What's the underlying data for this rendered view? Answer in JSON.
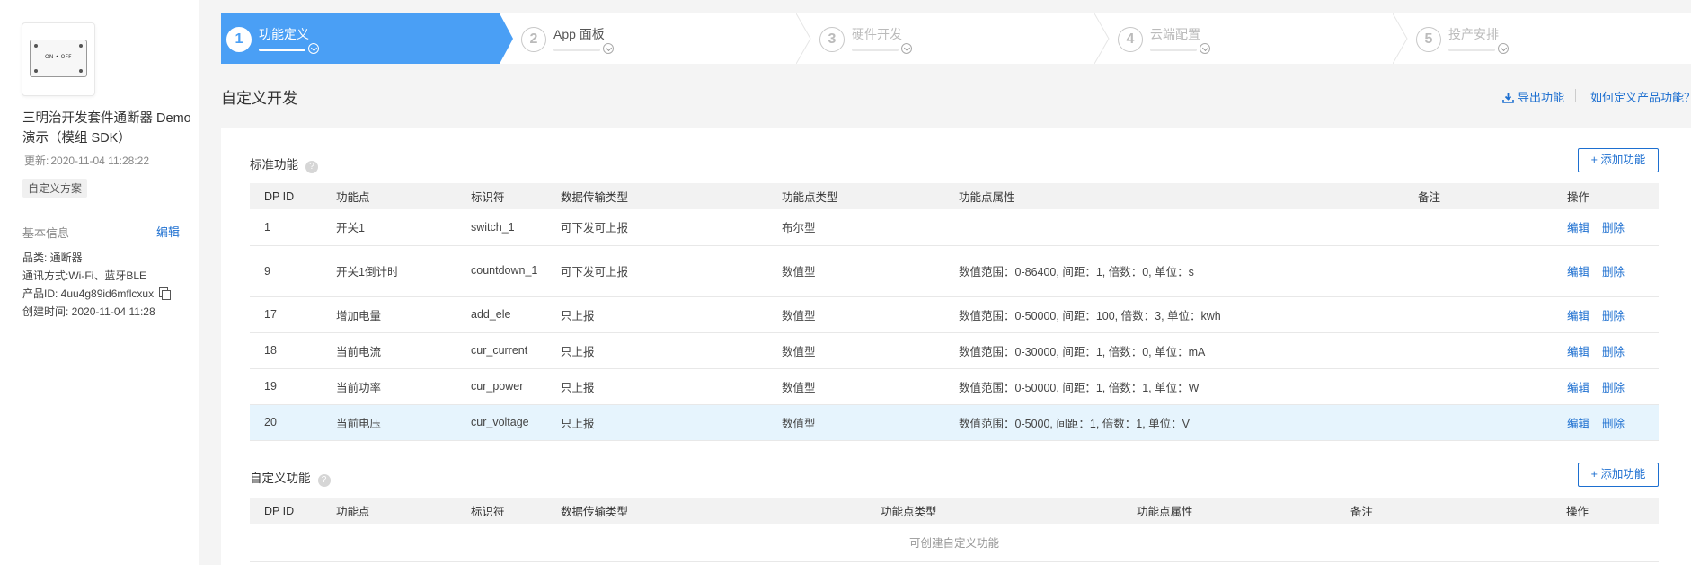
{
  "sidebar": {
    "product_image_text": "ON • OFF",
    "product_name": "三明治开发套件通断器 Demo 演示（模组 SDK）",
    "updated_label": "更新:",
    "updated_value": "2020-11-04 11:28:22",
    "solution_tag": "自定义方案",
    "basic_info_title": "基本信息",
    "edit_label": "编辑",
    "category": "品类: 通断器",
    "comm": "通讯方式:Wi-Fi、蓝牙BLE",
    "product_id": "产品ID: 4uu4g89id6mflcxux",
    "created": "创建时间: 2020-11-04 11:28"
  },
  "steps": [
    {
      "num": "1",
      "label": "功能定义",
      "active": true
    },
    {
      "num": "2",
      "label": "App 面板",
      "active": false
    },
    {
      "num": "3",
      "label": "硬件开发",
      "active": false
    },
    {
      "num": "4",
      "label": "云端配置",
      "active": false
    },
    {
      "num": "5",
      "label": "投产安排",
      "active": false
    }
  ],
  "header": {
    "title": "自定义开发",
    "export_label": "导出功能",
    "howto_label": "如何定义产品功能？"
  },
  "standard": {
    "title": "标准功能",
    "add_label": "+ 添加功能",
    "columns": [
      "DP ID",
      "功能点",
      "标识符",
      "数据传输类型",
      "功能点类型",
      "功能点属性",
      "备注",
      "操作"
    ],
    "rows": [
      {
        "id": "1",
        "name": "开关1",
        "code": "switch_1",
        "trans": "可下发可上报",
        "type": "布尔型",
        "attr": "",
        "note": "",
        "edit": "编辑",
        "del": "删除"
      },
      {
        "id": "9",
        "name": "开关1倒计时",
        "code": "countdown_1",
        "trans": "可下发可上报",
        "type": "数值型",
        "attr": "数值范围：0-86400, 间距：1, 倍数：0, 单位：s",
        "note": "",
        "edit": "编辑",
        "del": "删除"
      },
      {
        "id": "17",
        "name": "增加电量",
        "code": "add_ele",
        "trans": "只上报",
        "type": "数值型",
        "attr": "数值范围：0-50000, 间距：100, 倍数：3, 单位：kwh",
        "note": "",
        "edit": "编辑",
        "del": "删除"
      },
      {
        "id": "18",
        "name": "当前电流",
        "code": "cur_current",
        "trans": "只上报",
        "type": "数值型",
        "attr": "数值范围：0-30000, 间距：1, 倍数：0, 单位：mA",
        "note": "",
        "edit": "编辑",
        "del": "删除"
      },
      {
        "id": "19",
        "name": "当前功率",
        "code": "cur_power",
        "trans": "只上报",
        "type": "数值型",
        "attr": "数值范围：0-50000, 间距：1, 倍数：1, 单位：W",
        "note": "",
        "edit": "编辑",
        "del": "删除"
      },
      {
        "id": "20",
        "name": "当前电压",
        "code": "cur_voltage",
        "trans": "只上报",
        "type": "数值型",
        "attr": "数值范围：0-5000, 间距：1, 倍数：1, 单位：V",
        "note": "",
        "edit": "编辑",
        "del": "删除"
      }
    ]
  },
  "custom": {
    "title": "自定义功能",
    "add_label": "+ 添加功能",
    "columns": [
      "DP ID",
      "功能点",
      "标识符",
      "数据传输类型",
      "功能点类型",
      "功能点属性",
      "备注",
      "操作"
    ],
    "empty_text": "可创建自定义功能"
  },
  "colors": {
    "accent": "#4a9ff5",
    "link": "#1d6fd0",
    "highlight_row": "#e6f4fd"
  },
  "icons": [
    "help-icon",
    "download-icon",
    "copy-icon"
  ]
}
